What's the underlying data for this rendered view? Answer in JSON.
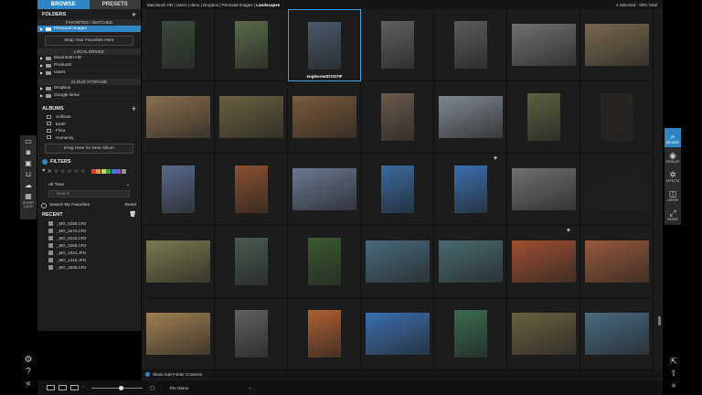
{
  "tabs": {
    "browse": "BROWSE",
    "presets": "PRESETS"
  },
  "folders": {
    "title": "FOLDERS",
    "favorites_head": "FAVORITES / WATCHED",
    "favorite_item": "Personal Images",
    "drop_favorites": "Drop Your Favorites Here",
    "local_head": "LOCAL DRIVES",
    "local_items": [
      "Macintosh HD",
      "Products",
      "Users"
    ],
    "cloud_head": "CLOUD STORAGE",
    "cloud_items": [
      "Dropbox",
      "Google Drive"
    ]
  },
  "albums": {
    "title": "ALBUMS",
    "items": [
      "Artifacts",
      "Earth",
      "Flora",
      "Humanity"
    ],
    "drop_album": "Drag Here for New Album"
  },
  "filters": {
    "title": "FILTERS",
    "time": "All Time",
    "search_placeholder": "Search",
    "favorites_label": "Search My Favorites",
    "reset": "Reset",
    "color_swatches": [
      "#d24040",
      "#d8a030",
      "#d8d040",
      "#40a040",
      "#3d7ad0",
      "#8a4ad0",
      "#909090"
    ]
  },
  "recent": {
    "title": "RECENT",
    "items": [
      "_MG_5255.CR2",
      "_MG_5274.CR2",
      "_MG_5233.CR2",
      "_MG_0269.CR2",
      "_MG_1623.JPG",
      "_MG_1416.JPG",
      "_MG_4609.CR2"
    ]
  },
  "pathbar": {
    "crumbs": [
      "Macintosh HD",
      "Users",
      "dano",
      "Dropbox",
      "Personal Images"
    ],
    "current": "Landscapes",
    "status": "1 Selected - 38% Total"
  },
  "grid": {
    "selected_filename": "englesreatOOS7IF",
    "images": [
      [
        "#3a4a3a",
        "#5a6a4a",
        "#4a5a6a",
        "#606060",
        "#5a5a5a",
        "#707070",
        "#7a6a50"
      ],
      [
        "#8a7050",
        "#6a6040",
        "#7a5a3a",
        "#6a5a4a",
        "#808890",
        "#5a6040",
        "#2a2420"
      ],
      [
        "#5a6a8a",
        "#8a5030",
        "#6a7890",
        "#3a6aa0",
        "#3a70b0",
        "#707070",
        "#1c1c1c"
      ],
      [
        "#7a7a50",
        "#4a5a50",
        "#3a5a30",
        "#4a6a7a",
        "#4a6a70",
        "#a05030",
        "#9a5a3a"
      ],
      [
        "#a08050",
        "#606060",
        "#b06030",
        "#3a70b0",
        "#3a6a50",
        "#6a6040",
        "#4a6a80"
      ]
    ],
    "footer_option": "Show Sub-Folder Contents"
  },
  "bottombar": {
    "sort": "File Name"
  },
  "right_rail": [
    "BROWSE",
    "DEVELOP",
    "EFFECTS",
    "LAYERS",
    "RESIZE"
  ],
  "left_rail": [
    "SHORT CUTS"
  ]
}
